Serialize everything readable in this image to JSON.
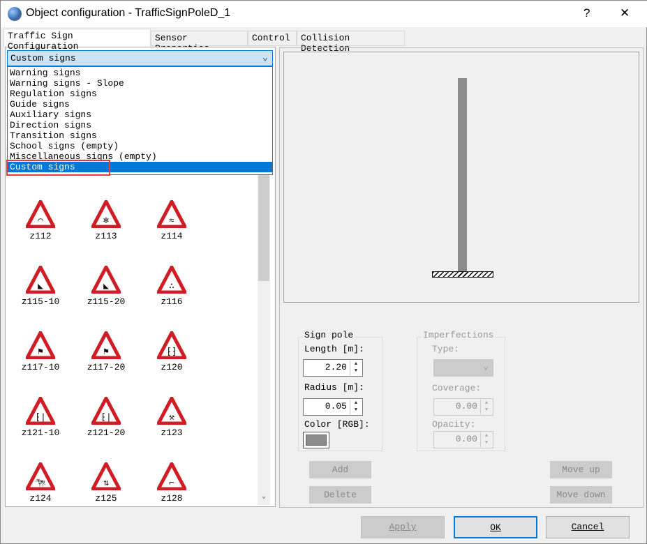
{
  "window": {
    "title": "Object configuration - TrafficSignPoleD_1",
    "help": "?",
    "close": "✕"
  },
  "tabs": [
    {
      "label": "Traffic Sign Configuration"
    },
    {
      "label": "Sensor Properties"
    },
    {
      "label": "Control"
    },
    {
      "label": "Collision Detection"
    }
  ],
  "category": {
    "selected": "Custom signs",
    "options": [
      "Warning signs",
      "Warning signs - Slope",
      "Regulation signs",
      "Guide signs",
      "Auxiliary signs",
      "Direction signs",
      "Transition signs",
      "School signs (empty)",
      "Miscellaneous signs (empty)",
      "Custom signs"
    ]
  },
  "signs": [
    {
      "label": "z112",
      "icon": "bumps"
    },
    {
      "label": "z113",
      "icon": "snowflake"
    },
    {
      "label": "z114",
      "icon": "slippery"
    },
    {
      "label": "z115-10",
      "icon": "falling-rocks"
    },
    {
      "label": "z115-20",
      "icon": "falling-rocks"
    },
    {
      "label": "z116",
      "icon": "gravel"
    },
    {
      "label": "z117-10",
      "icon": "windsock"
    },
    {
      "label": "z117-20",
      "icon": "windsock"
    },
    {
      "label": "z120",
      "icon": "road-narrows"
    },
    {
      "label": "z121-10",
      "icon": "road-narrows-side"
    },
    {
      "label": "z121-20",
      "icon": "road-narrows-side"
    },
    {
      "label": "z123",
      "icon": "roadworks"
    },
    {
      "label": "z124",
      "icon": "cattle"
    },
    {
      "label": "z125",
      "icon": "two-way-traffic"
    },
    {
      "label": "z128",
      "icon": "bridge"
    }
  ],
  "sign_pole": {
    "title": "Sign pole",
    "length_label": "Length [m]:",
    "length": "2.20",
    "radius_label": "Radius [m]:",
    "radius": "0.05",
    "color_label": "Color [RGB]:",
    "color": "#8c8c8c"
  },
  "imperfections": {
    "title": "Imperfections",
    "type_label": "Type:",
    "type": "",
    "coverage_label": "Coverage:",
    "coverage": "0.00",
    "opacity_label": "Opacity:",
    "opacity": "0.00"
  },
  "buttons": {
    "add": "Add",
    "delete": "Delete",
    "move_up": "Move up",
    "move_down": "Move down",
    "apply": "Apply",
    "ok": "OK",
    "cancel": "Cancel"
  }
}
